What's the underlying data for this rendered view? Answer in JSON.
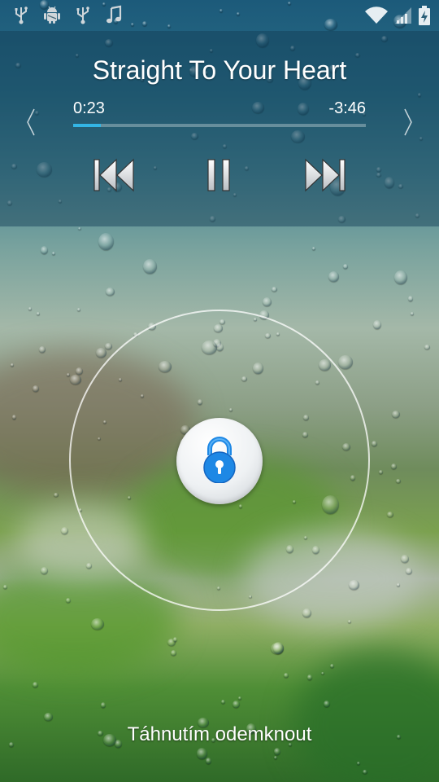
{
  "status_bar": {
    "left_icons": [
      "usb-icon",
      "android-debug-icon",
      "usb-icon",
      "music-note-icon"
    ],
    "right_icons": [
      "wifi-icon",
      "signal-icon",
      "battery-charging-icon"
    ]
  },
  "music": {
    "title": "Straight To Your Heart",
    "elapsed": "0:23",
    "remaining": "-3:46",
    "progress_fraction": 0.095,
    "accent_color": "#33b5e5",
    "prev_icon": "skip-previous-icon",
    "pause_icon": "pause-icon",
    "next_icon": "skip-next-icon"
  },
  "unlock": {
    "lock_icon": "lock-icon",
    "lock_color": "#1e88e5",
    "hint": "Táhnutím odemknout"
  }
}
